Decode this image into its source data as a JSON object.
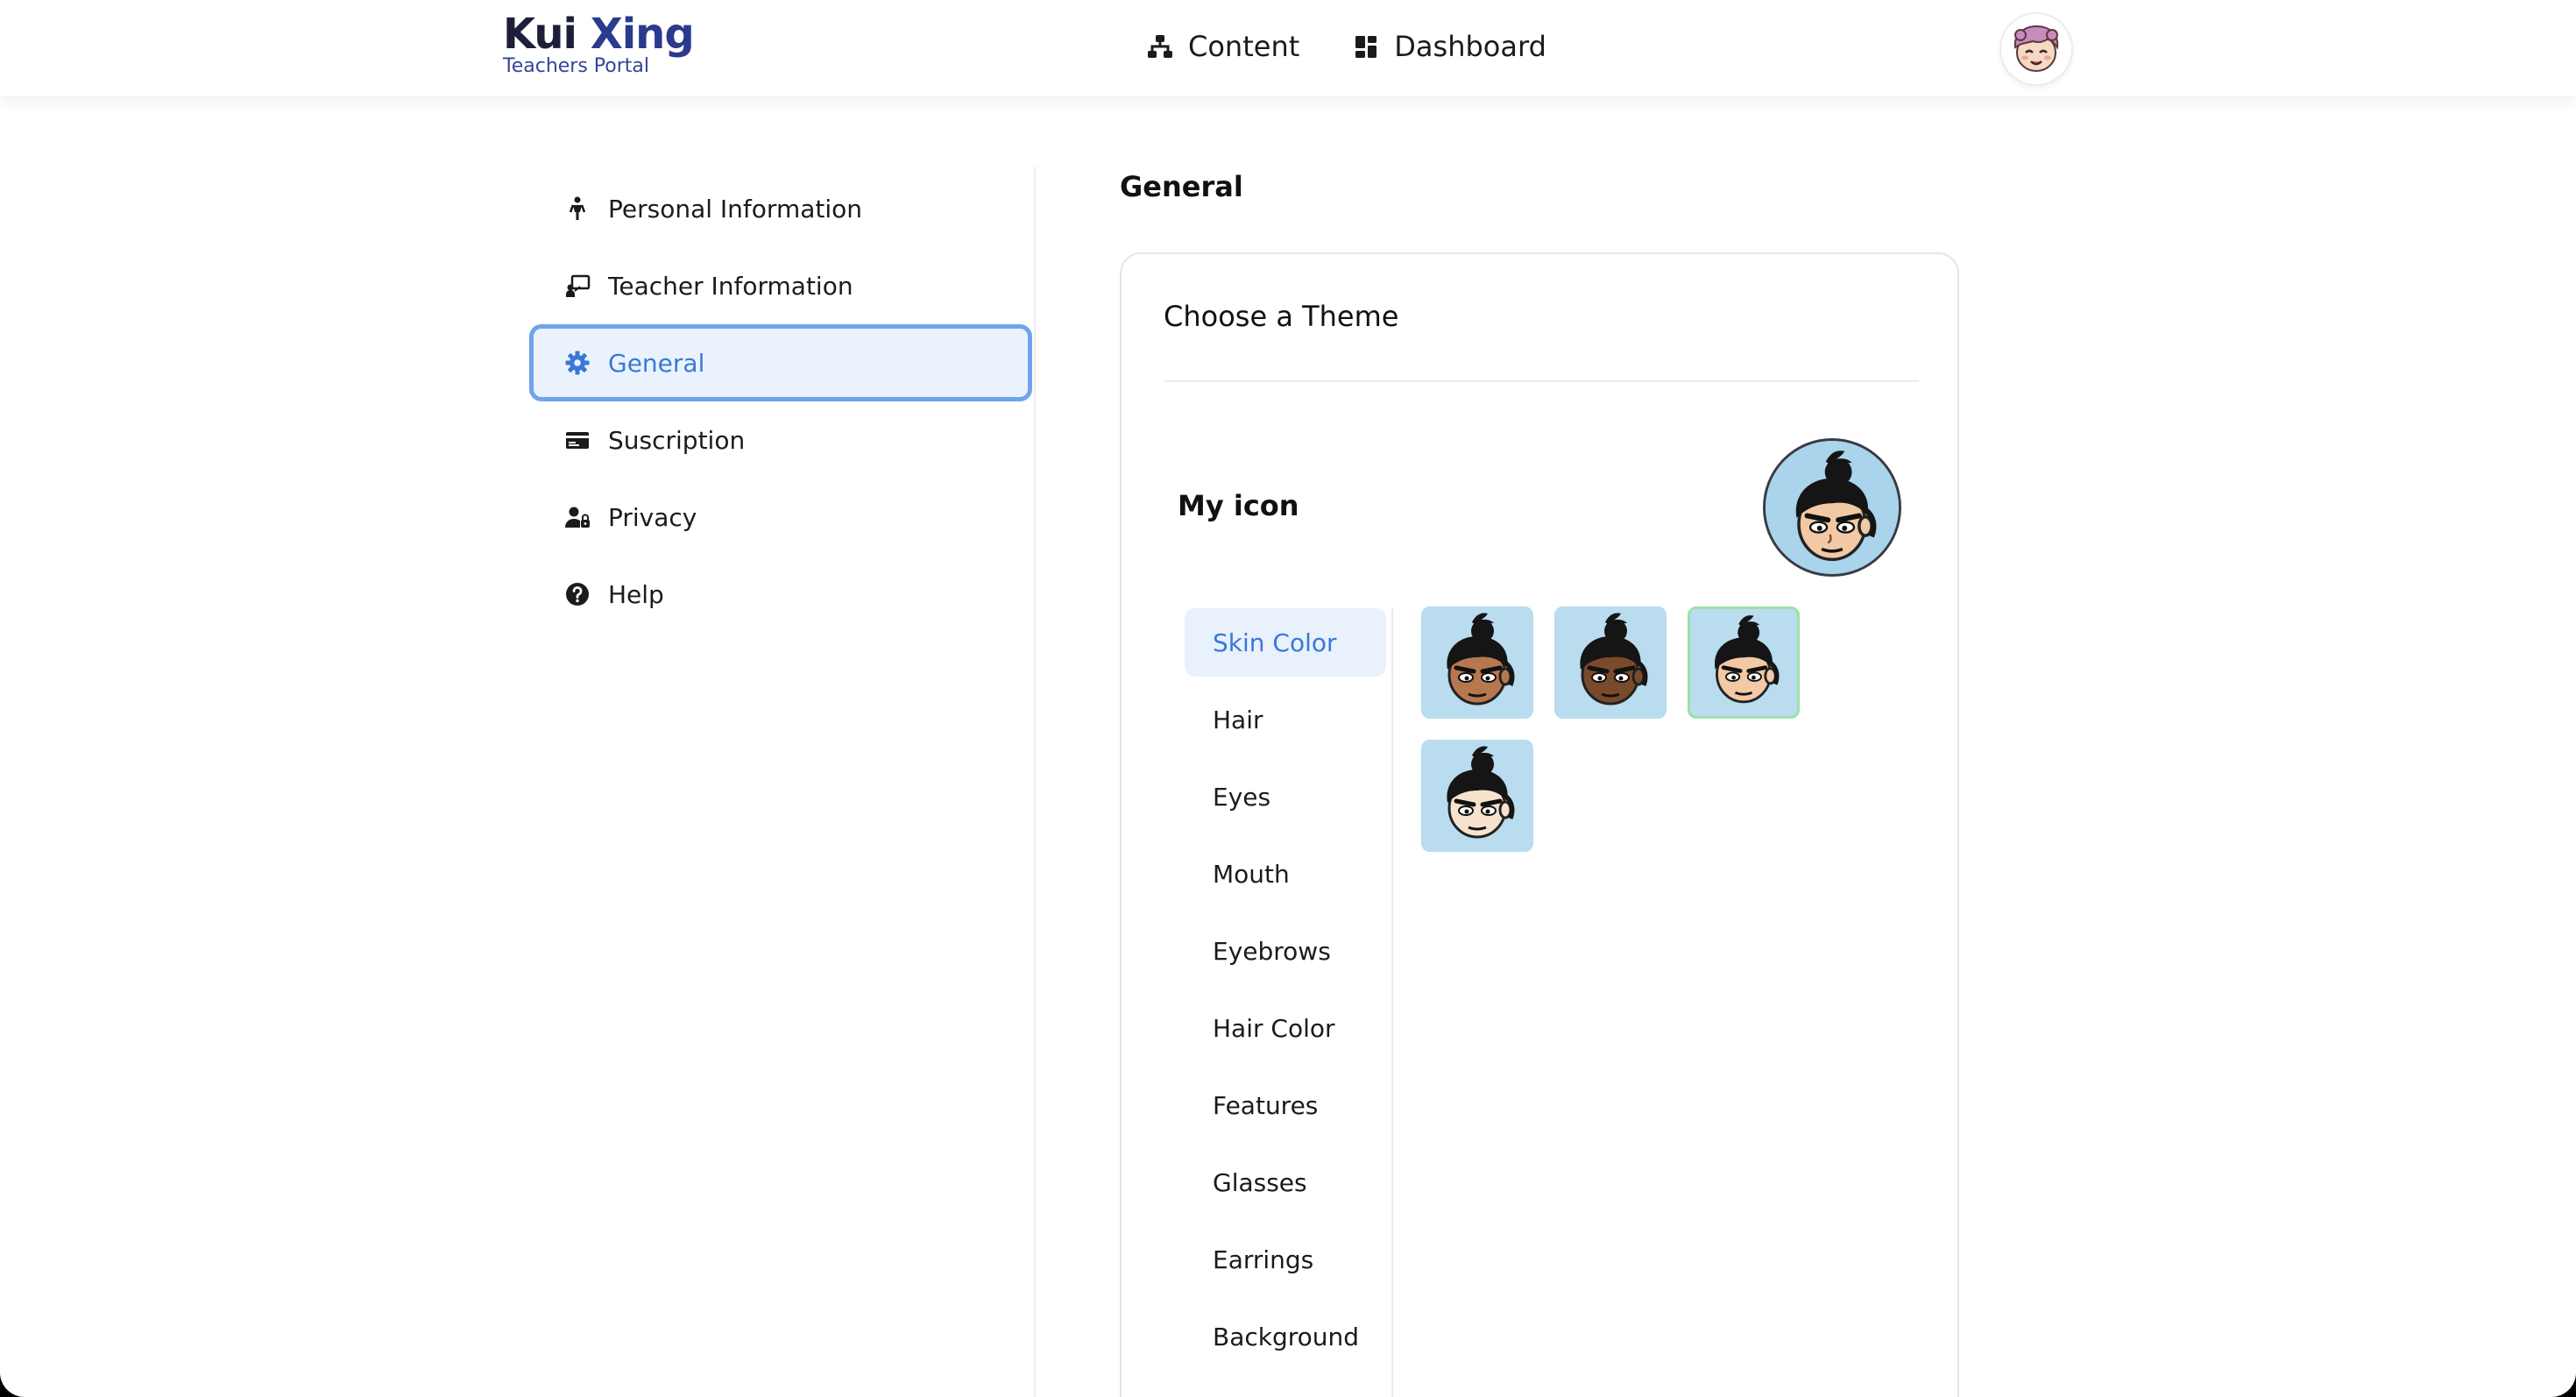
{
  "header": {
    "brand_part1": "Kui ",
    "brand_part2": "Xing",
    "brand_sub": "Teachers Portal",
    "nav": [
      {
        "label": "Content",
        "icon": "sitemap-icon"
      },
      {
        "label": "Dashboard",
        "icon": "dashboard-icon"
      }
    ]
  },
  "sidebar": {
    "items": [
      {
        "label": "Personal Information",
        "icon": "person-icon"
      },
      {
        "label": "Teacher Information",
        "icon": "teacher-icon"
      },
      {
        "label": "General",
        "icon": "gear-icon",
        "active": true
      },
      {
        "label": "Suscription",
        "icon": "card-icon"
      },
      {
        "label": "Privacy",
        "icon": "user-lock-icon"
      },
      {
        "label": "Help",
        "icon": "question-icon"
      }
    ]
  },
  "main": {
    "title": "General",
    "card": {
      "title": "Choose a Theme",
      "my_icon_label": "My icon",
      "categories": [
        {
          "label": "Skin Color",
          "active": true
        },
        {
          "label": "Hair"
        },
        {
          "label": "Eyes"
        },
        {
          "label": "Mouth"
        },
        {
          "label": "Eyebrows"
        },
        {
          "label": "Hair Color"
        },
        {
          "label": "Features"
        },
        {
          "label": "Glasses"
        },
        {
          "label": "Earrings"
        },
        {
          "label": "Background"
        }
      ],
      "skin_options": [
        {
          "skin": "#b8784f",
          "selected": false
        },
        {
          "skin": "#7a4a2a",
          "selected": false
        },
        {
          "skin": "#f2c9a4",
          "selected": true
        },
        {
          "skin": "#f7e3cd",
          "selected": false
        }
      ]
    }
  },
  "colors": {
    "accent": "#3a78d8",
    "active_bg": "#eaf3fd",
    "avatar_bg": "#b9dcef",
    "selected_border": "#9ee0a8"
  }
}
